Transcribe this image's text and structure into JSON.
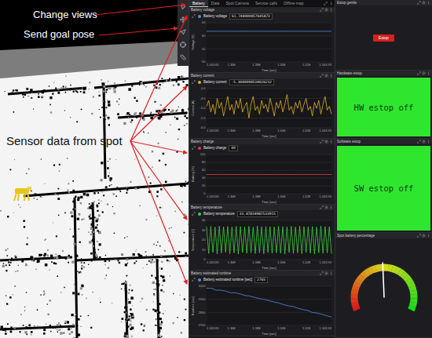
{
  "tabs": [
    {
      "label": "Battery",
      "selected": true
    },
    {
      "label": "Data",
      "selected": false
    },
    {
      "label": "Spot Camera",
      "selected": false
    },
    {
      "label": "Service calls",
      "selected": false
    },
    {
      "label": "Offline map",
      "selected": false
    }
  ],
  "annotations": [
    {
      "text": "Change views",
      "color": "#ffffff"
    },
    {
      "text": "Send goal pose",
      "color": "#ffffff"
    },
    {
      "text": "Sensor data from spot",
      "color": "#111111"
    }
  ],
  "charts": [
    {
      "title": "Battery voltage",
      "legend": "Battery voltage",
      "reading": "61.744000057645873",
      "color": "#4f8fe0",
      "y_label": "Voltage [V]",
      "y_ticks": [
        "65",
        "60",
        "55",
        "50"
      ],
      "x_label": "Time [sec]",
      "x_ticks": [
        "1.343.83",
        "1.36E",
        "1.38E",
        "1.30E",
        "1.32E",
        "1.343.93"
      ],
      "values": [
        61.74,
        61.75,
        61.74,
        61.73,
        61.74,
        61.74,
        61.75,
        61.74,
        61.74,
        61.73,
        61.74,
        61.74,
        61.75,
        61.74,
        61.74,
        61.73,
        61.74,
        61.74,
        61.74,
        61.74
      ]
    },
    {
      "title": "Battery current",
      "legend": "Battery current",
      "reading": "-5.3040000534026232",
      "color": "#e0b020",
      "y_label": "Current [A]",
      "y_ticks": [
        "-4.0",
        "-4.5",
        "-5.0",
        "-5.5",
        "-6.0"
      ],
      "x_label": "Time [sec]",
      "x_ticks": [
        "1.343.83",
        "1.36E",
        "1.38E",
        "1.30E",
        "1.32E",
        "1.343.93"
      ],
      "values": [
        -4.9,
        -4.6,
        -5.2,
        -4.8,
        -5.3,
        -4.5,
        -5.0,
        -4.7,
        -5.4,
        -4.9,
        -4.4,
        -5.1,
        -4.8,
        -5.3,
        -4.6,
        -5.0,
        -4.5,
        -5.2,
        -4.9,
        -4.7,
        -5.5,
        -4.8,
        -4.4,
        -5.1,
        -4.9,
        -5.3,
        -4.6,
        -5.0,
        -4.8,
        -5.2,
        -4.5,
        -4.9,
        -5.4,
        -4.7,
        -5.0,
        -4.6,
        -5.2,
        -4.8,
        -4.3,
        -5.1,
        -4.9,
        -5.3,
        -4.7,
        -5.0,
        -4.6,
        -5.2,
        -4.8,
        -4.5,
        -5.1,
        -4.9,
        -5.4,
        -4.7,
        -5.0,
        -4.6,
        -5.3,
        -4.8,
        -4.4,
        -5.1,
        -4.9,
        -5.3
      ]
    },
    {
      "title": "Battery charge",
      "legend": "Battery charge",
      "reading": "49",
      "color": "#e04040",
      "y_label": "Battery [%]",
      "y_ticks": [
        "100",
        "80",
        "60",
        "40",
        "20",
        "0"
      ],
      "x_label": "Time [sec]",
      "x_ticks": [
        "1.343.83",
        "1.36E",
        "1.38E",
        "1.30E",
        "1.32E",
        "1.343.93"
      ],
      "values": [
        49,
        49,
        49,
        49,
        49,
        49,
        49,
        49,
        49,
        49,
        49,
        49
      ]
    },
    {
      "title": "Battery temperature",
      "legend": "Battery temperature",
      "reading": "33.47834987533915",
      "color": "#3fcf3f",
      "y_label": "Temperature [C]",
      "y_ticks": [
        "40",
        "30",
        "20",
        "10",
        "0"
      ],
      "x_label": "Time [sec]",
      "x_ticks": [
        "1.343.83",
        "1.36E",
        "1.38E",
        "1.30E",
        "1.32E",
        "1.343.93"
      ],
      "values": [
        33.5,
        6.2,
        33.9,
        7.1,
        33.2,
        5.8,
        34.1,
        6.7,
        33.6,
        7.4,
        33.8,
        6.0,
        33.3,
        6.9,
        34.0,
        5.6,
        33.7,
        7.2,
        33.4,
        6.4,
        33.9,
        7.0,
        33.1,
        6.1,
        34.2,
        6.8,
        33.5,
        5.9,
        33.8,
        7.3,
        33.6,
        6.3,
        33.2,
        7.0,
        34.0,
        6.5,
        33.7,
        5.7,
        33.4,
        7.1,
        33.9,
        6.2,
        33.3,
        6.9,
        34.1,
        6.0,
        33.6,
        7.4,
        33.5,
        6.6,
        33.8,
        5.8,
        33.2,
        7.0,
        34.0,
        6.3,
        33.7,
        6.8,
        33.5,
        6.1
      ]
    },
    {
      "title": "Battery estimated runtime",
      "legend": "Battery estimated runtime [sec]",
      "reading": "2765",
      "color": "#4f8fe0",
      "y_label": "Runtime [sec]",
      "y_ticks": [
        "3000",
        "2900",
        "2800",
        "2700"
      ],
      "x_label": "Time [sec]",
      "x_ticks": [
        "1.343.83",
        "1.36E",
        "1.38E",
        "1.30E",
        "1.32E",
        "1.343.93"
      ],
      "values": [
        2985,
        2985,
        2970,
        2970,
        2962,
        2950,
        2950,
        2941,
        2930,
        2925,
        2915,
        2905,
        2900,
        2890,
        2880,
        2872,
        2860,
        2850,
        2845,
        2832,
        2822,
        2815,
        2800,
        2795,
        2785,
        2775,
        2765
      ]
    }
  ],
  "estop_gentle": {
    "title": "Estop gentle",
    "button": "Estop"
  },
  "estops": [
    {
      "title": "Hardware estop",
      "status": "HW estop off",
      "active": false
    },
    {
      "title": "Software estop",
      "status": "SW estop off",
      "active": false
    }
  ],
  "battery_gauge": {
    "title": "Spot battery percentage",
    "level": 0.49
  }
}
